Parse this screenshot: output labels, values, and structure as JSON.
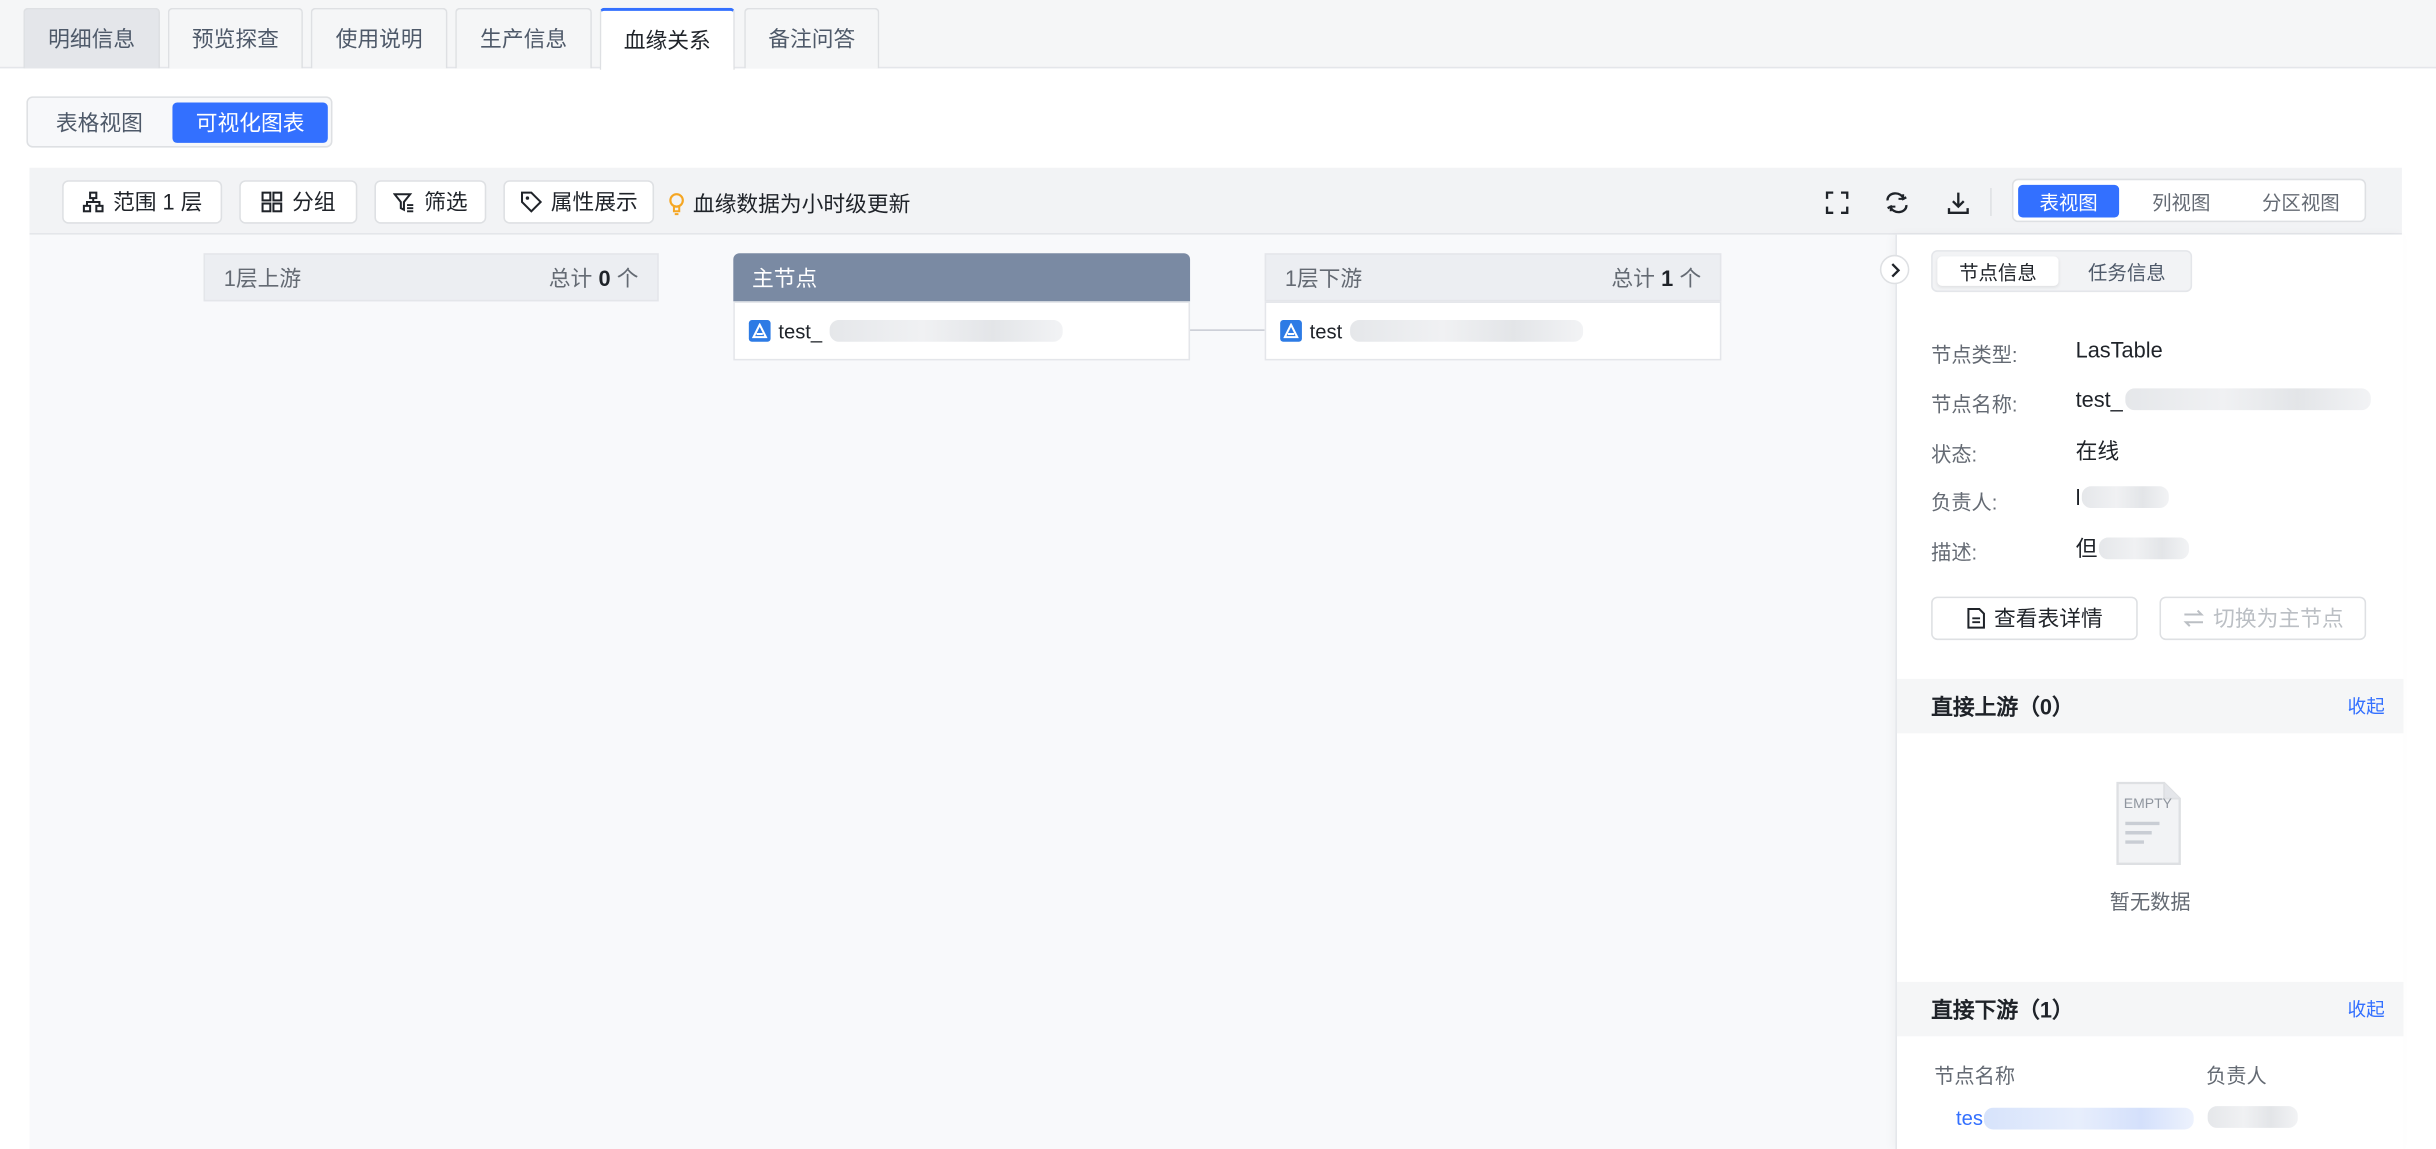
{
  "tabs": [
    {
      "label": "明细信息",
      "active": false
    },
    {
      "label": "预览探查",
      "active": false
    },
    {
      "label": "使用说明",
      "active": false
    },
    {
      "label": "生产信息",
      "active": false
    },
    {
      "label": "血缘关系",
      "active": true
    },
    {
      "label": "备注问答",
      "active": false
    }
  ],
  "view_switch": {
    "table_view": "表格视图",
    "chart_view": "可视化图表",
    "selected": "可视化图表"
  },
  "toolbar": {
    "scope": "范围 1 层",
    "group": "分组",
    "filter": "筛选",
    "attributes": "属性展示",
    "hint": "血缘数据为小时级更新",
    "icons": [
      "fullscreen-icon",
      "refresh-icon",
      "download-icon"
    ],
    "views": [
      "表视图",
      "列视图",
      "分区视图"
    ],
    "selected_view": "表视图"
  },
  "graph": {
    "upstream": {
      "title": "1层上游",
      "total_prefix": "总计",
      "count": "0",
      "unit": "个"
    },
    "main": {
      "title": "主节点",
      "node_name": "test_"
    },
    "downstream": {
      "title": "1层下游",
      "total_prefix": "总计",
      "count": "1",
      "unit": "个",
      "node_name": "test"
    },
    "accent": "#7a8aa3"
  },
  "panel": {
    "tabs": [
      "节点信息",
      "任务信息"
    ],
    "active_tab": "节点信息",
    "fields": [
      {
        "label": "节点类型:",
        "value": "LasTable"
      },
      {
        "label": "节点名称:",
        "value": "test_"
      },
      {
        "label": "状态:",
        "value": "在线"
      },
      {
        "label": "负责人:",
        "value": "l"
      },
      {
        "label": "描述:",
        "value": "但"
      }
    ],
    "view_detail": "查看表详情",
    "switch_main": "切换为主节点",
    "upstream_section": {
      "title": "直接上游（0）",
      "action": "收起",
      "empty_text": "暂无数据",
      "empty_icon_text": "EMPTY"
    },
    "downstream_section": {
      "title": "直接下游（1）",
      "action": "收起"
    },
    "downstream_table": {
      "columns": [
        "节点名称",
        "负责人"
      ],
      "rows": [
        {
          "name": "tes"
        }
      ]
    }
  },
  "colors": {
    "primary": "#3370ff",
    "table_icon": "#2d7be5"
  }
}
